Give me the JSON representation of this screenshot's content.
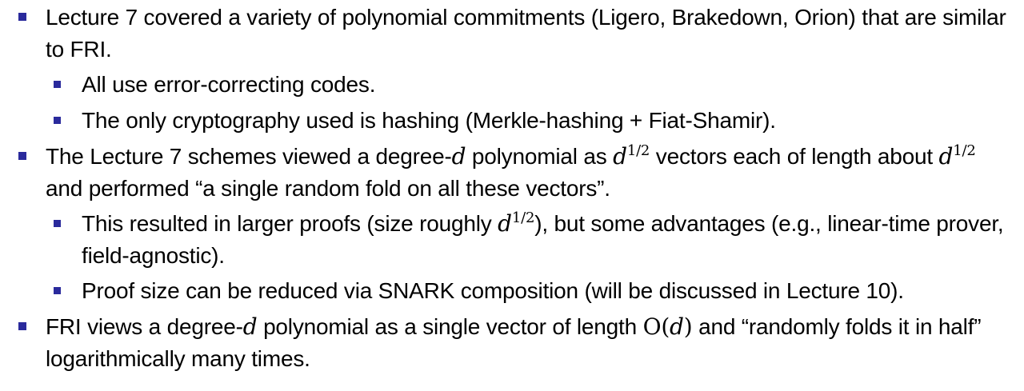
{
  "bullets": {
    "b1": {
      "text": "Lecture 7 covered a variety of polynomial commitments (Ligero, Brakedown, Orion) that are similar to FRI.",
      "sub1": "All use error-correcting codes.",
      "sub2": "The only cryptography used is hashing (Merkle-hashing + Fiat-Shamir)."
    },
    "b2": {
      "t1": "The Lecture 7 schemes viewed a degree-",
      "m1": "d",
      "t2": " polynomial as ",
      "m2": "d",
      "e2": "1/2",
      "t3": " vectors each of length about ",
      "m3": "d",
      "e3": "1/2",
      "t4": " and performed “a single random fold on all these vectors”.",
      "sub1": {
        "t1": "This resulted in larger proofs (size roughly ",
        "m1": "d",
        "e1": "1/2",
        "t2": "), but some advantages (e.g., linear-time prover, field-agnostic)."
      },
      "sub2": "Proof size can be reduced via SNARK composition (will be discussed in Lecture 10)."
    },
    "b3": {
      "t1": "FRI views a degree-",
      "m1": "d",
      "t2": " polynomial as a single vector of length ",
      "m2a": "O(",
      "m2b": "d",
      "m2c": ")",
      "t3": " and “randomly folds it in half” logarithmically many times."
    }
  },
  "colors": {
    "bullet": "#2a2a9c",
    "text": "#000000"
  }
}
